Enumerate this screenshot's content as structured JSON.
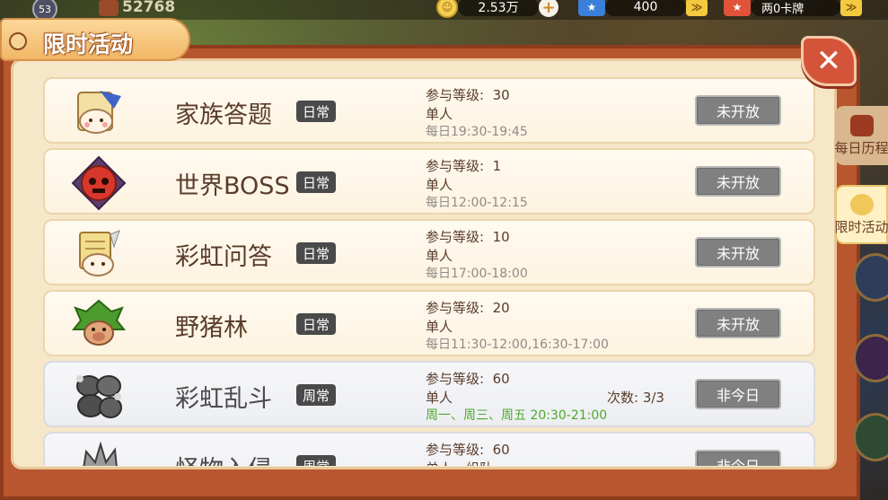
{
  "topbar": {
    "level": "53",
    "power": "52768",
    "gold": "2.53万",
    "gold_icon": "coin-icon",
    "diamond": "400",
    "extra_label": "两0卡牌",
    "chevron_icon": "double-chevron-icon"
  },
  "panel": {
    "title": "限时活动",
    "close_icon": "close-x-icon"
  },
  "activities": [
    {
      "name": "家族答题",
      "tag": "日常",
      "level_label": "参与等级:",
      "level": "30",
      "mode": "单人",
      "time": "每日19:30-19:45",
      "count": "",
      "state": "未开放",
      "icon": "quiz-scroll-icon",
      "style": "warm"
    },
    {
      "name": "世界BOSS",
      "tag": "日常",
      "level_label": "参与等级:",
      "level": "1",
      "mode": "单人",
      "time": "每日12:00-12:15",
      "count": "",
      "state": "未开放",
      "icon": "red-skull-boss-icon",
      "style": "warm"
    },
    {
      "name": "彩虹问答",
      "tag": "日常",
      "level_label": "参与等级:",
      "level": "10",
      "mode": "单人",
      "time": "每日17:00-18:00",
      "count": "",
      "state": "未开放",
      "icon": "rainbow-quiz-scroll-icon",
      "style": "warm"
    },
    {
      "name": "野猪林",
      "tag": "日常",
      "level_label": "参与等级:",
      "level": "20",
      "mode": "单人",
      "time": "每日11:30-12:00,16:30-17:00",
      "count": "",
      "state": "未开放",
      "icon": "boar-forest-icon",
      "style": "warm"
    },
    {
      "name": "彩虹乱斗",
      "tag": "周常",
      "level_label": "参与等级:",
      "level": "60",
      "mode": "单人",
      "time": "周一、周三、周五 20:30-21:00",
      "count": "次数: 3/3",
      "state": "非今日",
      "icon": "rainbow-brawl-icon",
      "style": "gray"
    },
    {
      "name": "怪物入侵",
      "tag": "周常",
      "level_label": "参与等级:",
      "level": "60",
      "mode": "单人、组队",
      "time": "",
      "count": "",
      "state": "非今日",
      "icon": "monster-invasion-icon",
      "style": "gray"
    }
  ],
  "side_tabs": [
    {
      "label": "每日历程",
      "icon": "daily-journey-icon",
      "active": false
    },
    {
      "label": "限时活动",
      "icon": "clock-icon",
      "active": true
    }
  ],
  "colors": {
    "panel_outer": "#b8572f",
    "panel_inner": "#f7e7c9",
    "tag_bg": "#4a4a4a",
    "btn_disabled": "#808080",
    "green_time": "#4ea92a"
  }
}
